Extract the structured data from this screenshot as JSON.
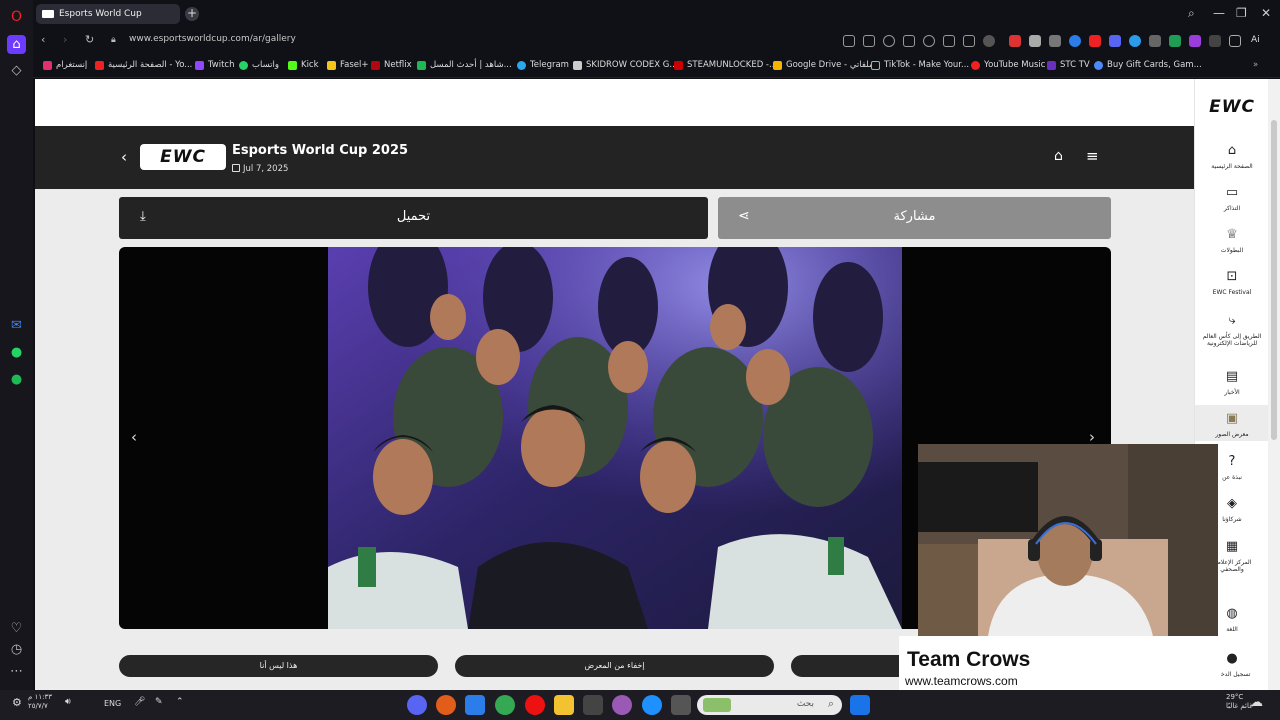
{
  "browser": {
    "tab_title": "Esports World Cup",
    "url": "www.esportsworldcup.com/ar/gallery",
    "ai_label": "Ai",
    "bookmarks": [
      "إنستغرام",
      "YouTube",
      "الصفحة الرئيسية - Yo...",
      "Twitch",
      "واتساب",
      "Kick",
      "Fasel+",
      "Netflix",
      "شاهد | أحدث المسل...",
      "Telegram",
      "SKIDROW CODEX G...",
      "STEAMUNLOCKED -...",
      "Google Drive - ملفاتي",
      "TikTok - Make Your...",
      "YouTube Music",
      "STC TV",
      "Buy Gift Cards, Gam..."
    ]
  },
  "event": {
    "logo_text": "EWC",
    "title": "Esports World Cup 2025",
    "date": "Jul 7, 2025"
  },
  "actions": {
    "download_label": "تحميل",
    "share_label": "مشاركة"
  },
  "gallery": {
    "pills": [
      "هذا ليس أنا",
      "إخفاء من المعرض",
      ""
    ]
  },
  "rightnav": {
    "logo": "EWC",
    "items": [
      {
        "label": "الصفحة الرئيسية",
        "icon": "home-icon"
      },
      {
        "label": "التذاكر",
        "icon": "ticket-icon"
      },
      {
        "label": "البطولات",
        "icon": "trophy-icon"
      },
      {
        "label": "EWC Festival",
        "icon": "gamepad-icon"
      },
      {
        "label": "الطريق إلى كأس العالم للرياضات الإلكترونية",
        "icon": "route-icon"
      },
      {
        "label": "الأخبار",
        "icon": "news-icon"
      },
      {
        "label": "معرض الصور",
        "icon": "gallery-icon"
      },
      {
        "label": "نبذة عن",
        "icon": "help-icon"
      },
      {
        "label": "شركاؤنا",
        "icon": "partners-icon"
      },
      {
        "label": "المركز الإعلامي والصحفي",
        "icon": "media-icon"
      },
      {
        "label": "اللغة",
        "icon": "globe-icon"
      },
      {
        "label": "تسجيل الدخول",
        "icon": "user-icon"
      }
    ]
  },
  "overlay": {
    "team_name": "Team Crows",
    "team_url": "www.teamcrows.com"
  },
  "taskbar": {
    "time": "١١:٣٣ م",
    "date": "٢٥/٧/٧",
    "lang": "ENG",
    "search_placeholder": "بحث",
    "weather_temp": "29°C",
    "weather_desc": "غائم غالبًا"
  },
  "colors": {
    "header_bg": "#232323",
    "share_bg": "#8d8d8d",
    "page_bg": "#ececec"
  }
}
